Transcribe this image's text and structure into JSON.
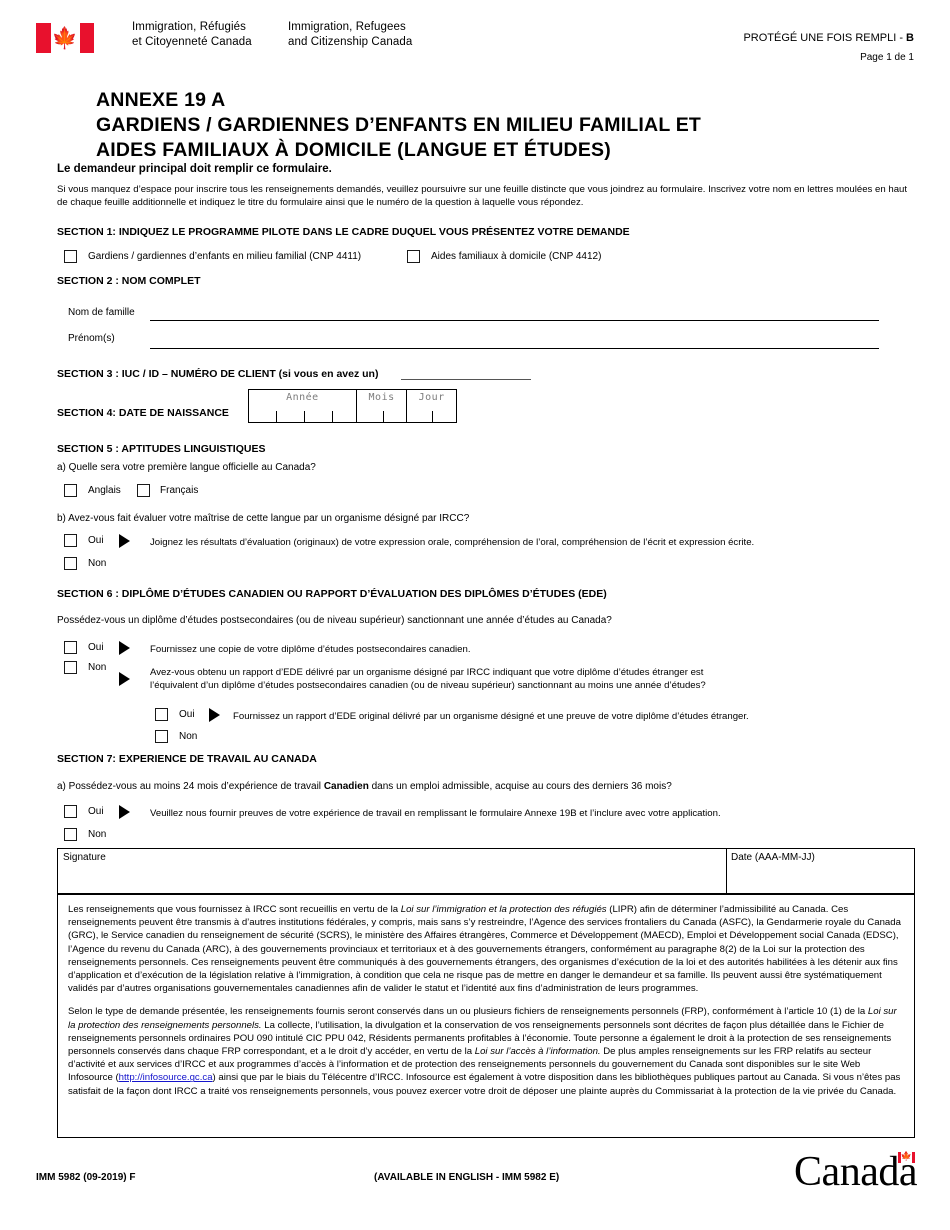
{
  "header": {
    "flag_icon": "canada-flag-icon",
    "department_fr_line1": "Immigration, Réfugiés",
    "department_fr_line2": "et Citoyenneté Canada",
    "department_en_line1": "Immigration, Refugees",
    "department_en_line2": "and Citizenship Canada",
    "protected_text": "PROTÉGÉ UNE FOIS REMPLI - ",
    "protected_level": "B",
    "page_number": "Page 1 de 1"
  },
  "title": {
    "line1": "ANNEXE 19 A",
    "line2": "GARDIENS / GARDIENNES D’ENFANTS EN MILIEU FAMILIAL ET",
    "line3": "AIDES FAMILIAUX À DOMICILE (LANGUE ET ÉTUDES)",
    "subtitle": "Le demandeur principal doit remplir ce formulaire.",
    "intro": "Si vous manquez d’espace pour inscrire tous les renseignements demandés, veuillez poursuivre sur une feuille distincte que vous joindrez au formulaire. Inscrivez votre nom en lettres moulées en haut de chaque feuille additionnelle et indiquez le titre du formulaire ainsi que le numéro de la question à laquelle vous répondez."
  },
  "section1": {
    "heading": "SECTION 1: INDIQUEZ LE PROGRAMME PILOTE DANS LE CADRE DUQUEL VOUS PRÉSENTEZ VOTRE DEMANDE",
    "option1": "Gardiens / gardiennes d’enfants en milieu familial (CNP 4411)",
    "option2": "Aides familiaux à domicile (CNP 4412)"
  },
  "section2": {
    "heading": "SECTION 2 : NOM COMPLET",
    "label_surname": "Nom de famille",
    "label_given": "Prénom(s)",
    "value_surname": "",
    "value_given": ""
  },
  "section3": {
    "heading": "SECTION 3 : IUC / ID – NUMÉRO DE CLIENT (si vous en avez un)",
    "value": ""
  },
  "section4": {
    "heading": "SECTION 4:   DATE DE NAISSANCE",
    "col_year": "Année",
    "col_month": "Mois",
    "col_day": "Jour",
    "value_year": "",
    "value_month": "",
    "value_day": ""
  },
  "section5": {
    "heading": "SECTION 5 :  APTITUDES LINGUISTIQUES",
    "qa": "a) Quelle sera votre première langue officielle au Canada?",
    "opt_english": "Anglais",
    "opt_french": "Français",
    "qb": "b) Avez-vous fait évaluer votre maîtrise de cette langue par un organisme désigné par IRCC?",
    "yes": "Oui",
    "no": "Non",
    "yes_instruction": "Joignez les résultats d’évaluation (originaux) de votre expression orale, compréhension de l’oral, compréhension de l’écrit et expression écrite."
  },
  "section6": {
    "heading": "SECTION 6 : DIPLÔME D’ÉTUDES CANADIEN OU RAPPORT D’ÉVALUATION DES DIPLÔMES D’ÉTUDES (EDE)",
    "question": "Possédez-vous un diplôme d’études postsecondaires (ou de niveau supérieur) sanctionnant une année d’études au Canada?",
    "yes": "Oui",
    "no": "Non",
    "yes_instruction": "Fournissez une copie de votre diplôme d’études postsecondaires canadien.",
    "no_instruction_line1": "Avez-vous obtenu un rapport d’EDE délivré par un organisme désigné par IRCC indiquant que votre diplôme d’études étranger est",
    "no_instruction_line2": "l’équivalent d’un diplôme d’études postsecondaires canadien (ou de niveau supérieur) sanctionnant au moins une année d’études?",
    "sub_yes": "Oui",
    "sub_no": "Non",
    "sub_yes_instruction": "Fournissez un rapport d’EDE original délivré par un organisme désigné et une preuve de votre diplôme d’études étranger."
  },
  "section7": {
    "heading": "SECTION 7: EXPERIENCE DE TRAVAIL AU CANADA",
    "qa_part1": "a) Possédez-vous au moins 24 mois d’expérience de travail ",
    "qa_bold": "Canadien",
    "qa_part2": " dans un emploi admissible, acquise au cours des derniers 36 mois?",
    "yes": "Oui",
    "no": "Non",
    "yes_instruction": "Veuillez nous fournir preuves de votre expérience de travail en remplissant le formulaire Annexe 19B et l’inclure avec votre application."
  },
  "signature": {
    "label": "Signature",
    "date_label": "Date (AAA-MM-JJ)",
    "value": "",
    "date_value": ""
  },
  "privacy": {
    "p1_a": "Les renseignements que vous fournissez à IRCC sont recueillis en vertu de la ",
    "p1_i1": "Loi sur l’immigration et la protection des réfugiés",
    "p1_b": " (LIPR) afin de déterminer l’admissibilité au Canada.  Ces renseignements peuvent être transmis à d’autres institutions fédérales, y compris, mais sans s’y restreindre, l’Agence des services frontaliers du Canada (ASFC), la Gendarmerie royale du Canada (GRC), le Service canadien du renseignement de sécurité (SCRS), le ministère des Affaires étrangères, Commerce et Développement (MAECD), Emploi et Développement social Canada (EDSC), l’Agence du revenu du Canada (ARC), à des gouvernements provinciaux et territoriaux et à des gouvernements étrangers, conformément au paragraphe 8(2) de la Loi sur la protection des renseignements personnels.  Ces renseignements peuvent être communiqués à des gouvernements étrangers, des organismes d’exécution de la loi et des autorités habilitées à les détenir aux fins d’application et d’exécution de la législation relative à l’immigration, à condition que cela ne risque pas de mettre en danger le demandeur et sa famille.  Ils peuvent aussi être systématiquement validés par d’autres organisations gouvernementales canadiennes afin de valider le statut et l’identité aux fins d’administration de leurs programmes.",
    "p2_a": "Selon le type de demande présentée, les renseignements fournis seront conservés dans un ou plusieurs fichiers de renseignements personnels (FRP), conformément à l’article 10 (1) de la ",
    "p2_i1": "Loi sur la protection des renseignements personnels.",
    "p2_b": " La collecte, l’utilisation, la divulgation et la conservation de vos renseignements personnels sont décrites de façon plus détaillée dans le Fichier de renseignements personnels ordinaires POU 090 intitulé CIC PPU 042, Résidents permanents profitables à l’économie. Toute personne a également le droit à la protection de ses renseignements personnels conservés dans chaque FRP correspondant, et a le droit d’y accéder, en vertu de la ",
    "p2_i2": "Loi sur l’accès à l’information.",
    "p2_c": "  De plus amples renseignements sur les FRP relatifs au secteur d’activité et aux services d’IRCC et aux programmes d’accès à l’information et de protection des renseignements personnels du gouvernement du Canada sont disponibles sur le site Web Infosource (",
    "p2_link": "http://infosource.gc.ca",
    "p2_d": ") ainsi que par le biais du Télécentre d’IRCC.  Infosource est également à votre disposition dans les bibliothèques publiques partout au Canada.  Si vous n’êtes pas satisfait de la façon dont IRCC a traité vos renseignements personnels, vous pouvez exercer votre droit de déposer une plainte auprès du Commissariat à la protection de la vie privée du Canada."
  },
  "footer": {
    "form_code": "IMM 5982 (09-2019) F",
    "available_en": "(AVAILABLE IN ENGLISH - IMM 5982 E)",
    "wordmark": "Canada",
    "wordmark_flag_icon": "canada-flag-icon"
  }
}
